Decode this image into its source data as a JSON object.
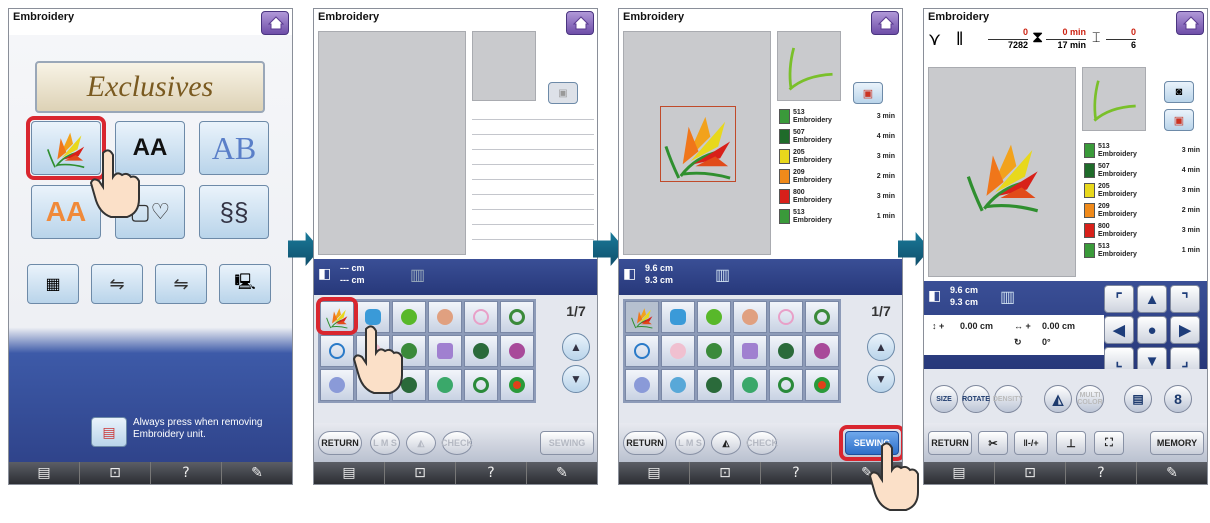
{
  "screen_title": "Embroidery",
  "bottom_bar": [
    "▤",
    "⊡",
    "?",
    "✎"
  ],
  "s1": {
    "exclusives_label": "Exclusives",
    "font_btns": [
      "AA",
      "AB"
    ],
    "notice": "Always press when removing Embroidery unit."
  },
  "s2": {
    "size_w": "--- cm",
    "size_h": "--- cm",
    "page_num": "1",
    "page_den": "7",
    "return_label": "RETURN",
    "lms_label": "L M S",
    "check_label": "CHECK",
    "sewing_label": "SEWING"
  },
  "s3": {
    "size_w": "9.6 cm",
    "size_h": "9.3 cm",
    "page_num": "1",
    "page_den": "7",
    "return_label": "RETURN",
    "lms_label": "L M S",
    "check_label": "CHECK",
    "sewing_label": "SEWING",
    "colors": [
      {
        "code": "513",
        "name": "Embroidery",
        "time": "3 min",
        "hex": "#3a9a3a"
      },
      {
        "code": "507",
        "name": "Embroidery",
        "time": "4 min",
        "hex": "#1f6b2a"
      },
      {
        "code": "205",
        "name": "Embroidery",
        "time": "3 min",
        "hex": "#e8d81c"
      },
      {
        "code": "209",
        "name": "Embroidery",
        "time": "2 min",
        "hex": "#f08a1a"
      },
      {
        "code": "800",
        "name": "Embroidery",
        "time": "3 min",
        "hex": "#d8201a"
      },
      {
        "code": "513",
        "name": "Embroidery",
        "time": "1 min",
        "hex": "#3a9a3a"
      }
    ]
  },
  "s4": {
    "stitch_done": "0",
    "stitch_total": "7282",
    "time_done": "0 min",
    "time_total": "17 min",
    "color_done": "0",
    "color_total": "6",
    "size_w": "9.6 cm",
    "size_h": "9.3 cm",
    "offset_v": "0.00 cm",
    "offset_h": "0.00 cm",
    "angle": "0°",
    "size_label": "SIZE",
    "rotate_label": "ROTATE",
    "density_label": "DENSITY",
    "multicolor_label": "MULTI COLOR",
    "return_label": "RETURN",
    "memory_label": "MEMORY",
    "colors": [
      {
        "code": "513",
        "name": "Embroidery",
        "time": "3 min",
        "hex": "#3a9a3a"
      },
      {
        "code": "507",
        "name": "Embroidery",
        "time": "4 min",
        "hex": "#1f6b2a"
      },
      {
        "code": "205",
        "name": "Embroidery",
        "time": "3 min",
        "hex": "#e8d81c"
      },
      {
        "code": "209",
        "name": "Embroidery",
        "time": "2 min",
        "hex": "#f08a1a"
      },
      {
        "code": "800",
        "name": "Embroidery",
        "time": "3 min",
        "hex": "#d8201a"
      },
      {
        "code": "513",
        "name": "Embroidery",
        "time": "1 min",
        "hex": "#3a9a3a"
      }
    ]
  }
}
